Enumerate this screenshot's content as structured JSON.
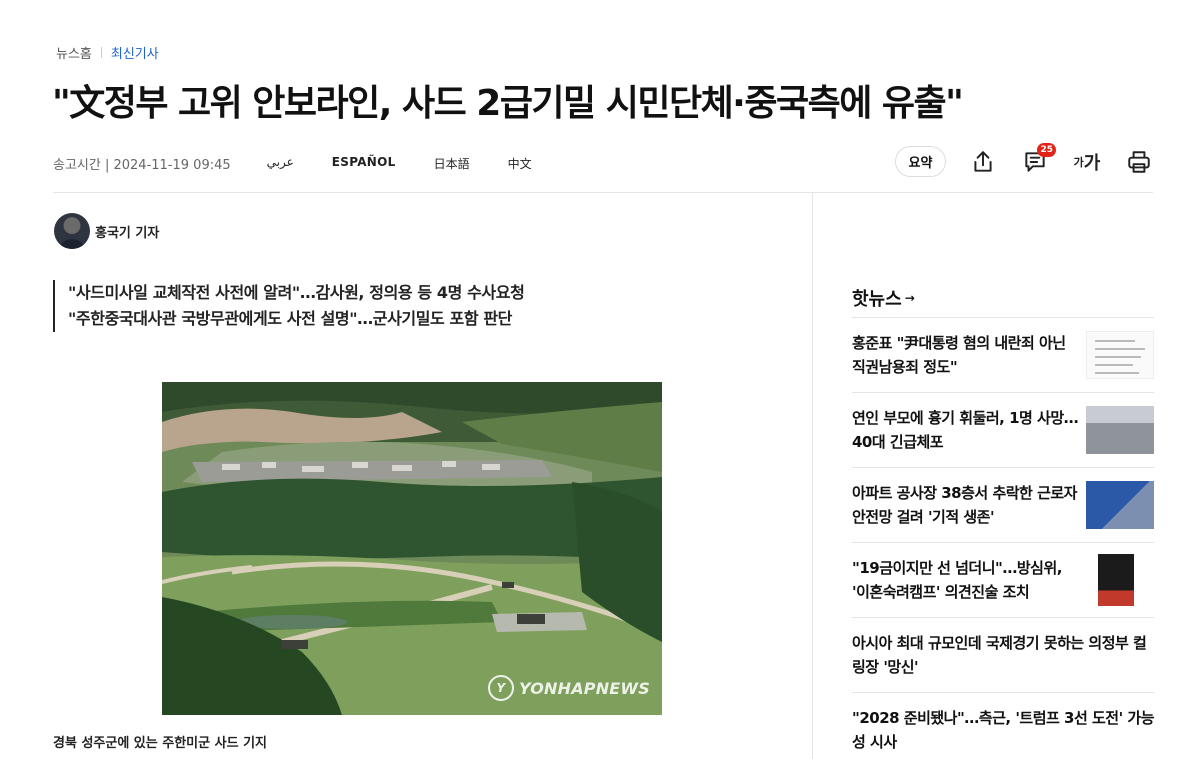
{
  "breadcrumb": {
    "home": "뉴스홈",
    "current": "최신기사"
  },
  "headline": "\"文정부 고위 안보라인, 사드 2급기밀 시민단체·중국측에 유출\"",
  "meta": {
    "sent_time": "송고시간 | 2024-11-19 09:45",
    "languages": [
      "عربي",
      "ESPAÑOL",
      "日本語",
      "中文"
    ]
  },
  "tools": {
    "summary_label": "요약",
    "comment_count": "25",
    "font_small": "가",
    "font_big": "가"
  },
  "author": {
    "name": "홍국기 기자"
  },
  "subtitles": [
    "\"사드미사일 교체작전 사전에 알려\"…감사원, 정의용 등 4명 수사요청",
    "\"주한중국대사관 국방무관에게도 사전 설명\"…군사기밀도 포함 판단"
  ],
  "photo": {
    "watermark": "YONHAPNEWS",
    "caption": "경북 성주군에 있는 주한미군 사드 기지"
  },
  "hot_news": {
    "title": "핫뉴스",
    "items": [
      {
        "text": "홍준표 \"尹대통령 혐의 내란죄 아닌 직권남용죄 정도\"",
        "thumb": "document"
      },
      {
        "text": "연인 부모에 흉기 휘둘러, 1명 사망…40대 긴급체포",
        "thumb": "building"
      },
      {
        "text": "아파트 공사장 38층서 추락한 근로자 안전망 걸려 '기적 생존'",
        "thumb": "construction"
      },
      {
        "text": "\"19금이지만 선 넘더니\"…방심위, '이혼숙려캠프' 의견진술 조치",
        "thumb": "poster"
      },
      {
        "text": "아시아 최대 규모인데 국제경기 못하는 의정부 컬링장 '망신'",
        "thumb": ""
      },
      {
        "text": "\"2028 준비됐나\"…측근, '트럼프 3선 도전' 가능성 시사",
        "thumb": ""
      }
    ]
  },
  "colors": {
    "accent": "#1e64c8",
    "badge": "#e2231a"
  }
}
